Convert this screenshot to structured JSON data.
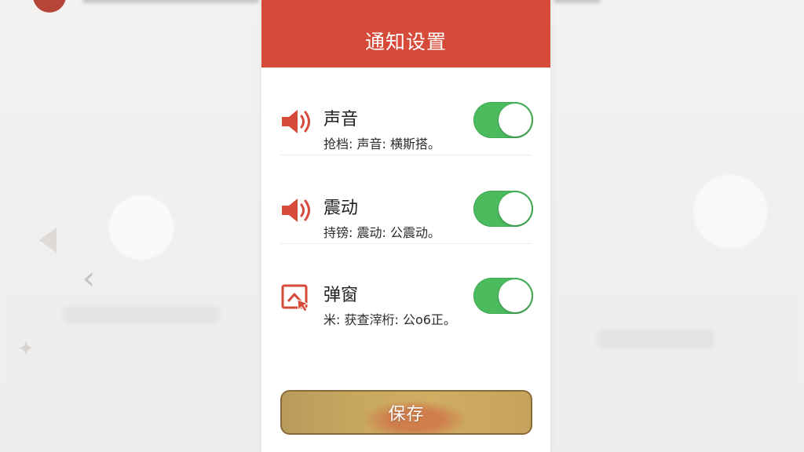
{
  "header": {
    "title": "通知设置"
  },
  "settings": [
    {
      "title": "声音",
      "subtitle": "抢档: 声音: 横斯搭。",
      "icon": "speaker-icon",
      "enabled": true
    },
    {
      "title": "震动",
      "subtitle": "持镑: 震动: 公震动。",
      "icon": "speaker-icon",
      "enabled": true
    },
    {
      "title": "弹窗",
      "subtitle": "米: 获查滓桁: 公o6正。",
      "icon": "popup-cursor-icon",
      "enabled": true
    }
  ],
  "save_button": {
    "label": "保存"
  },
  "colors": {
    "header_bg": "#d64a3a",
    "toggle_on": "#4cbb5e",
    "icon_red": "#d64a3a",
    "save_gold": "#c8a85f"
  }
}
